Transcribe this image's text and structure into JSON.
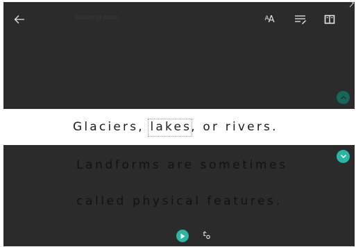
{
  "toolbar": {
    "title": "Bodies of water",
    "back_icon": "arrow-left-icon",
    "text_preferences_icon": "text-size-icon",
    "text_preferences_label_big": "A",
    "text_preferences_label_small": "A",
    "grammar_options_icon": "grammar-options-icon",
    "reading_preferences_icon": "open-book-icon"
  },
  "reader": {
    "focus_line": {
      "before": "Glaciers, ",
      "highlighted_word": "lakes",
      "after": ", or rivers."
    },
    "next_lines": [
      "Landforms are sometimes",
      "called physical features."
    ]
  },
  "controls": {
    "previous_line_icon": "chevron-up-icon",
    "next_line_icon": "chevron-down-icon",
    "play_icon": "play-icon",
    "voice_settings_icon": "voice-settings-icon"
  },
  "colors": {
    "background": "#2b2b2b",
    "accent": "#2bb5a2",
    "focus_band": "#ffffff",
    "focus_text": "#1c1c1c",
    "icon": "#e8e8e8"
  }
}
